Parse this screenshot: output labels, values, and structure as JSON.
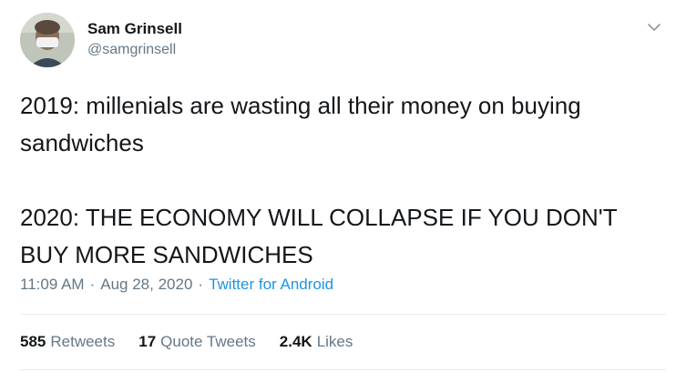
{
  "author": {
    "name": "Sam Grinsell",
    "handle": "@samgrinsell"
  },
  "tweet": {
    "text": "2019: millenials are wasting all their money on buying sandwiches\n\n2020: THE ECONOMY WILL COLLAPSE IF YOU DON'T BUY MORE SANDWICHES",
    "time": "11:09 AM",
    "separator": "·",
    "date": "Aug 28, 2020",
    "source": "Twitter for Android"
  },
  "stats": {
    "retweets_count": "585",
    "retweets_label": "Retweets",
    "quotes_count": "17",
    "quotes_label": "Quote Tweets",
    "likes_count": "2.4K",
    "likes_label": "Likes"
  },
  "icons": {
    "menu": "chevron-down-icon"
  },
  "colors": {
    "text_primary": "#14171a",
    "text_secondary": "#657786",
    "link": "#1b95e0",
    "divider": "#e6ecf0"
  }
}
